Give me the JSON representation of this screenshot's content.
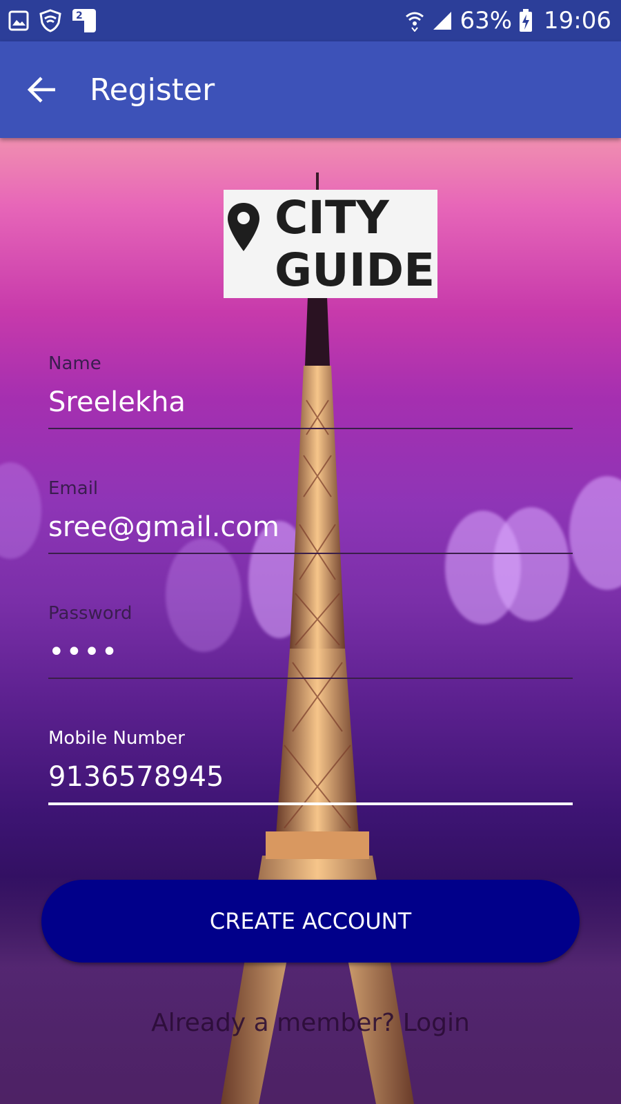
{
  "status_bar": {
    "icons": [
      "gallery-icon",
      "shield-icon",
      "sim-2-icon",
      "wifi-icon",
      "signal-icon",
      "battery-charging-icon"
    ],
    "sim_badge": "2",
    "battery_percent": "63%",
    "time": "19:06"
  },
  "app_bar": {
    "title": "Register",
    "back_icon": "arrow-back-icon"
  },
  "logo": {
    "line1": "CITY",
    "line2": "GUIDE",
    "icon": "map-pin-icon"
  },
  "form": {
    "name_label": "Name",
    "name_value": "Sreelekha",
    "email_label": "Email",
    "email_value": "sree@gmail.com",
    "password_label": "Password",
    "password_value": "••••",
    "mobile_label": "Mobile Number",
    "mobile_value": "9136578945"
  },
  "create_button": "CREATE ACCOUNT",
  "login_link": "Already a member? Login",
  "colors": {
    "status_bar": "#2c3e99",
    "app_bar": "#3d52b8",
    "button": "#01008a"
  }
}
